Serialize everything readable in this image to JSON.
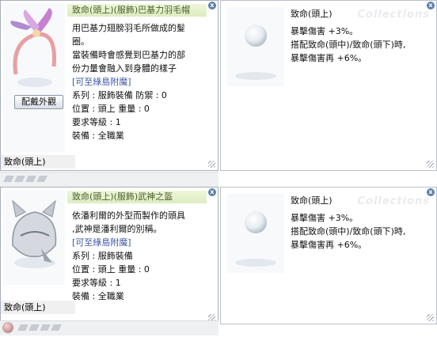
{
  "top_left": {
    "title": "致命(頭上)(服飾)巴基力羽毛帽",
    "description_lines": [
      "用巴基力翅膀羽毛所做成的髮",
      "圈。",
      "當裝備時會感覺到巴基力的部",
      "份力量會融入到身體的樣子"
    ],
    "link": "[可至綠島附魔]",
    "appearance_button": "配戴外觀",
    "stats": [
      "系列 : 服飾裝備  防禦 : 0",
      "位置 : 頭上  重量 : 0",
      "要求等級 : 1",
      "裝備 : 全職業"
    ],
    "label_bar": "致命(頭上)"
  },
  "top_right": {
    "title": "致命(頭上)",
    "lines": [
      "暴擊傷害 +3%。",
      "搭配致命(頭中)/致命(頭下)時,",
      "暴擊傷害再 +6%。"
    ],
    "watermark": "Collections"
  },
  "bottom_left": {
    "title": "致命(頭上)(服飾)武神之盔",
    "description_lines": [
      "依潘利爾的外型而製作的頭具",
      ",武神是潘利爾的別稱。"
    ],
    "link": "[可至綠島附魔]",
    "stats": [
      "系列 : 服飾裝備",
      "位置 : 頭上  重量 : 0",
      "要求等級 : 1",
      "裝備 : 全職業"
    ],
    "label_bar": "致命(頭上)"
  },
  "bottom_right": {
    "title": "致命(頭上)",
    "lines": [
      "暴擊傷害 +3%。",
      "搭配致命(頭中)/致命(頭下)時,",
      "暴擊傷害再 +6%。"
    ],
    "watermark": "Collections"
  },
  "icons": {
    "close": "close-icon",
    "item_slot": "item-slot-icon"
  },
  "colors": {
    "title_bg": "#dcecc2",
    "title_text": "#4a5e2a",
    "link": "#3d55a7",
    "close": "#5b7fae"
  }
}
